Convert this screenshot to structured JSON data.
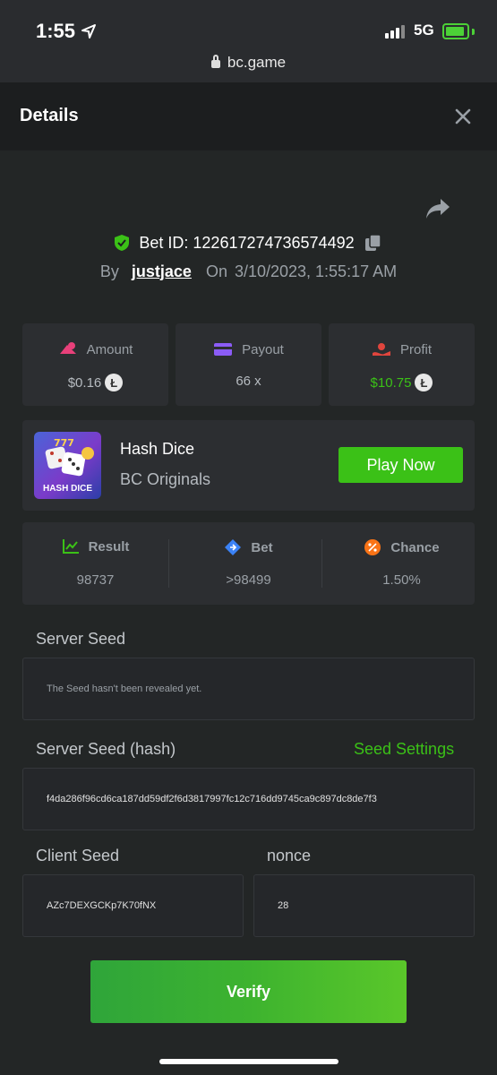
{
  "status_bar": {
    "time": "1:55",
    "network": "5G",
    "url": "bc.game"
  },
  "header": {
    "title": "Details"
  },
  "bet": {
    "id_label": "Bet ID: 122617274736574492",
    "by_label": "By",
    "user": "justjace",
    "on_label": "On",
    "datetime": "3/10/2023, 1:55:17 AM"
  },
  "stats": [
    {
      "label": "Amount",
      "value": "$0.16",
      "color": "#e8407a"
    },
    {
      "label": "Payout",
      "value": "66 x",
      "color": "#8b5cf6"
    },
    {
      "label": "Profit",
      "value": "$10.75",
      "color": "#e0453d"
    }
  ],
  "profit_color": "#3bc117",
  "game": {
    "name": "Hash Dice",
    "provider": "BC Originals",
    "thumb_label": "HASH DICE",
    "play_label": "Play Now"
  },
  "results": [
    {
      "label": "Result",
      "value": "98737",
      "color": "#3bc117"
    },
    {
      "label": "Bet",
      "value": ">98499",
      "color": "#3b82f6"
    },
    {
      "label": "Chance",
      "value": "1.50%",
      "color": "#f97316"
    }
  ],
  "server_seed": {
    "label": "Server Seed",
    "value": "The Seed hasn't been revealed yet."
  },
  "server_seed_hash": {
    "label": "Server Seed (hash)",
    "settings_label": "Seed Settings",
    "value": "f4da286f96cd6ca187dd59df2f6d3817997fc12c716dd9745ca9c897dc8de7f3"
  },
  "client_seed": {
    "label": "Client Seed",
    "value": "AZc7DEXGCKp7K70fNX"
  },
  "nonce": {
    "label": "nonce",
    "value": "28"
  },
  "verify_label": "Verify"
}
